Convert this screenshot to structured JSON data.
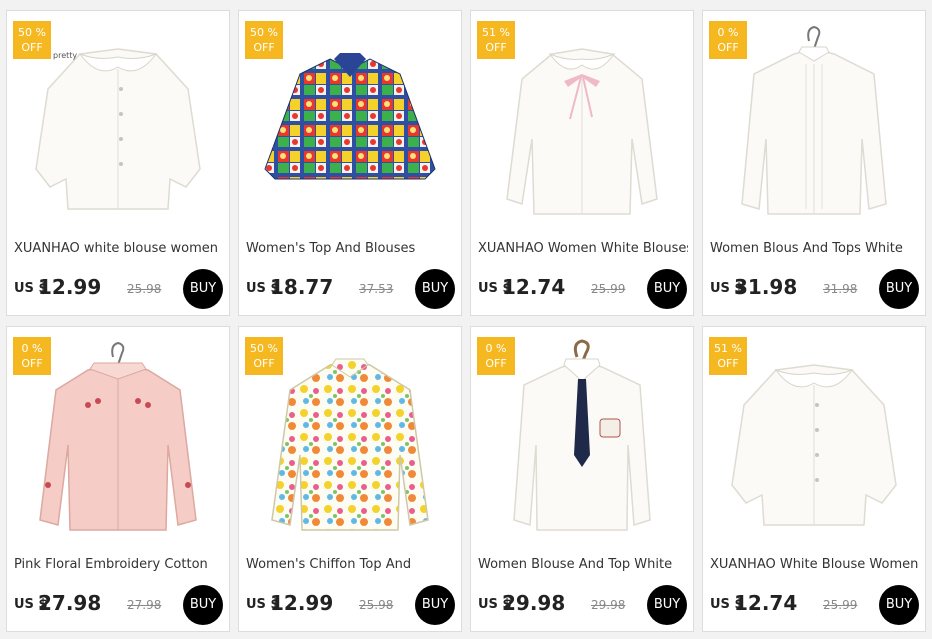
{
  "currency": "US $",
  "buy_label": "BUY",
  "off_label": "OFF",
  "colors": {
    "badge": "#f5b820",
    "buy_button": "#000000"
  },
  "products": [
    {
      "discount": "50 %",
      "title": "XUANHAO white blouse women",
      "price": "12.99",
      "old_price": "25.98",
      "image": "white-ruffle-collar-blouse",
      "watermark": "pretty"
    },
    {
      "discount": "50 %",
      "title": "Women's Top And Blouses",
      "price": "18.77",
      "old_price": "37.53",
      "image": "colorful-print-blouse",
      "watermark": ""
    },
    {
      "discount": "51 %",
      "title": "XUANHAO Women White Blouses",
      "price": "12.74",
      "old_price": "25.99",
      "image": "white-blouse-pink-bow",
      "watermark": ""
    },
    {
      "discount": "0 %",
      "title": "Women Blous And Tops White",
      "price": "31.98",
      "old_price": "31.98",
      "image": "white-pleated-blouse-hanger",
      "watermark": ""
    },
    {
      "discount": "0 %",
      "title": "Pink Floral Embroidery Cotton",
      "price": "27.98",
      "old_price": "27.98",
      "image": "pink-floral-shirt",
      "watermark": ""
    },
    {
      "discount": "50 %",
      "title": "Women's Chiffon Top And",
      "price": "12.99",
      "old_price": "25.98",
      "image": "cartoon-print-shirt",
      "watermark": ""
    },
    {
      "discount": "0 %",
      "title": "Women Blouse And Top White",
      "price": "29.98",
      "old_price": "29.98",
      "image": "white-shirt-navy-tie",
      "watermark": ""
    },
    {
      "discount": "51 %",
      "title": "XUANHAO White Blouse Women",
      "price": "12.74",
      "old_price": "25.99",
      "image": "white-ruffle-collar-blouse",
      "watermark": ""
    }
  ]
}
